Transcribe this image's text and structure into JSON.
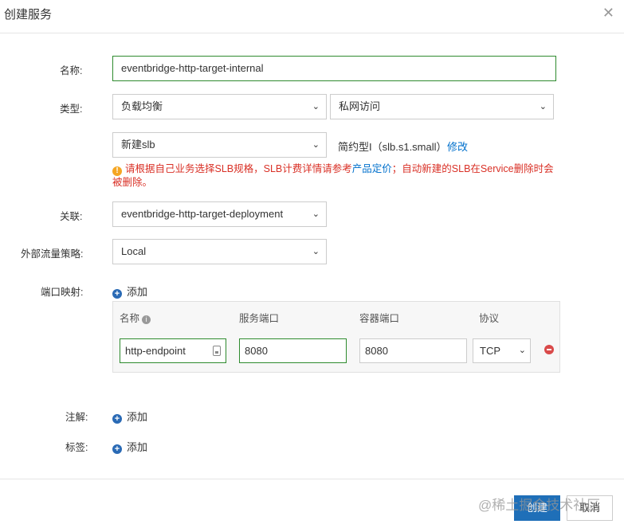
{
  "dialog": {
    "title": "创建服务",
    "close_icon": "close-icon"
  },
  "form": {
    "name": {
      "label": "名称:",
      "value": "eventbridge-http-target-internal"
    },
    "type": {
      "label": "类型:",
      "select1": "负载均衡",
      "select2": "私网访问",
      "slb_select": "新建slb",
      "slb_spec": "简约型I（slb.s1.small）",
      "modify_link": "修改",
      "warning_part1": "请根据自己业务选择SLB规格，SLB计费详情请参考",
      "warning_link": "产品定价",
      "warning_part2": "；自动新建的SLB在Service删除时会被删除。"
    },
    "association": {
      "label": "关联:",
      "value": "eventbridge-http-target-deployment"
    },
    "external_policy": {
      "label": "外部流量策略:",
      "value": "Local"
    },
    "port_mapping": {
      "label": "端口映射:",
      "add_label": "添加",
      "headers": {
        "name": "名称",
        "service_port": "服务端口",
        "container_port": "容器端口",
        "protocol": "协议"
      },
      "rows": [
        {
          "name": "http-endpoint",
          "service_port": "8080",
          "container_port": "8080",
          "protocol": "TCP"
        }
      ]
    },
    "annotations": {
      "label": "注解:",
      "add_label": "添加"
    },
    "labels": {
      "label": "标签:",
      "add_label": "添加"
    }
  },
  "footer": {
    "create_label": "创建",
    "cancel_label": "取消",
    "watermark": "@稀土掘金技术社区"
  },
  "colors": {
    "primary": "#1f6fb8",
    "link": "#0070cc",
    "warning": "#d93026",
    "focus_border": "#2e8b2e"
  }
}
